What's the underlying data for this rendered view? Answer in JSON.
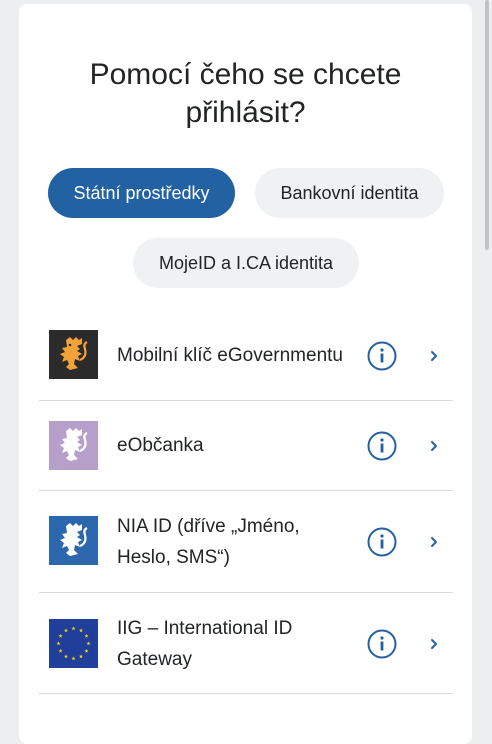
{
  "heading": {
    "line1": "Pomocí čeho se chcete",
    "line2": "přihlásit?"
  },
  "tabs": [
    {
      "label": "Státní prostředky",
      "active": true
    },
    {
      "label": "Bankovní identita",
      "active": false
    },
    {
      "label": "MojeID a I.CA identita",
      "active": false
    }
  ],
  "methods": [
    {
      "label": "Mobilní klíč eGovernmentu",
      "icon": "czech-lion-logo-dark",
      "icon_bg": "#2b2b2b"
    },
    {
      "label": "eObčanka",
      "icon": "czech-lion-logo-lavender",
      "icon_bg": "#b79fcb"
    },
    {
      "label": "NIA ID (dříve „Jméno, Heslo, SMS“)",
      "icon": "czech-lion-logo-blue",
      "icon_bg": "#2c67ad"
    },
    {
      "label": "IIG – International ID Gateway",
      "icon": "eu-flag-logo",
      "icon_bg": "#1f3f9a"
    }
  ],
  "colors": {
    "accent": "#2362a2",
    "text": "#222426",
    "pill_inactive": "#f0f1f2",
    "divider": "#d9dcdf"
  }
}
